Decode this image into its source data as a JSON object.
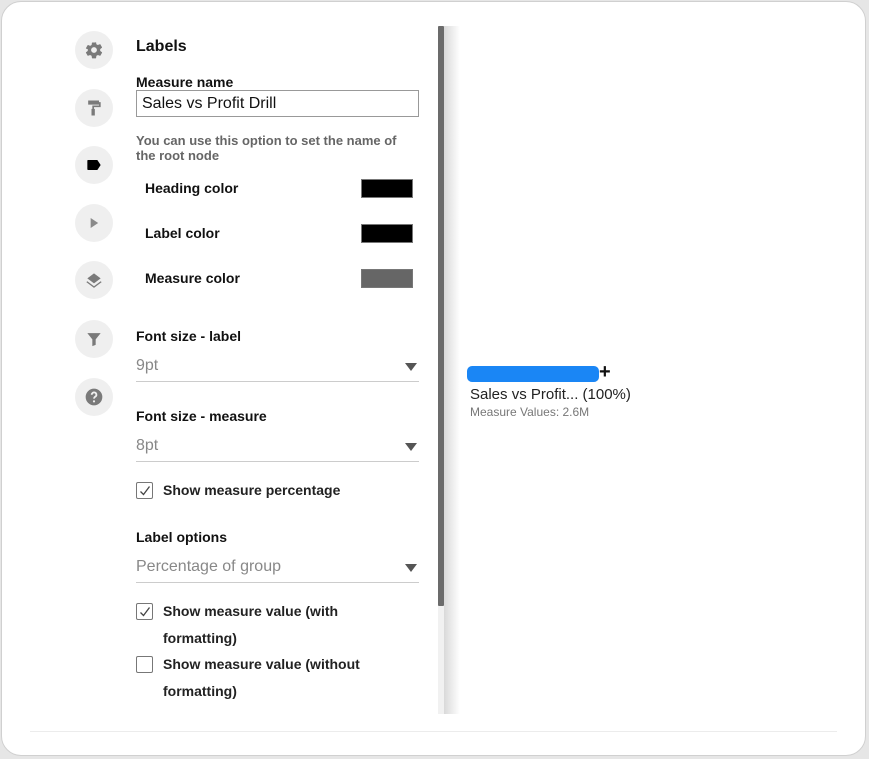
{
  "icons": [
    {
      "name": "gear-icon",
      "label": "Settings"
    },
    {
      "name": "paint-roller-icon",
      "label": "Format"
    },
    {
      "name": "label-tag-icon",
      "label": "Labels",
      "active": true
    },
    {
      "name": "play-icon",
      "label": "Animation"
    },
    {
      "name": "layers-icon",
      "label": "Layers"
    },
    {
      "name": "filter-icon",
      "label": "Filter"
    },
    {
      "name": "help-icon",
      "label": "Help"
    }
  ],
  "panel": {
    "title": "Labels",
    "measure_name_label": "Measure name",
    "measure_name_value": "Sales vs Profit Drill",
    "hint": "You can use this option to set the name of the root node",
    "colors": [
      {
        "label": "Heading color",
        "value": "#000000"
      },
      {
        "label": "Label color",
        "value": "#000000"
      },
      {
        "label": "Measure color",
        "value": "#666666"
      }
    ],
    "font_size_label": {
      "label": "Font size - label",
      "value": "9pt"
    },
    "font_size_measure": {
      "label": "Font size - measure",
      "value": "8pt"
    },
    "show_measure_percentage": {
      "label": "Show measure percentage",
      "checked": true
    },
    "label_options": {
      "label": "Label options",
      "value": "Percentage of group"
    },
    "show_value_with_formatting": {
      "label": "Show measure value (with formatting)",
      "checked": true
    },
    "show_value_without_formatting": {
      "label": "Show measure value (without formatting)",
      "checked": false
    }
  },
  "viz": {
    "bar_color": "#1a86f5",
    "expand_symbol": "+",
    "node_label": "Sales vs Profit... (100%)",
    "node_measure": "Measure Values: 2.6M"
  }
}
